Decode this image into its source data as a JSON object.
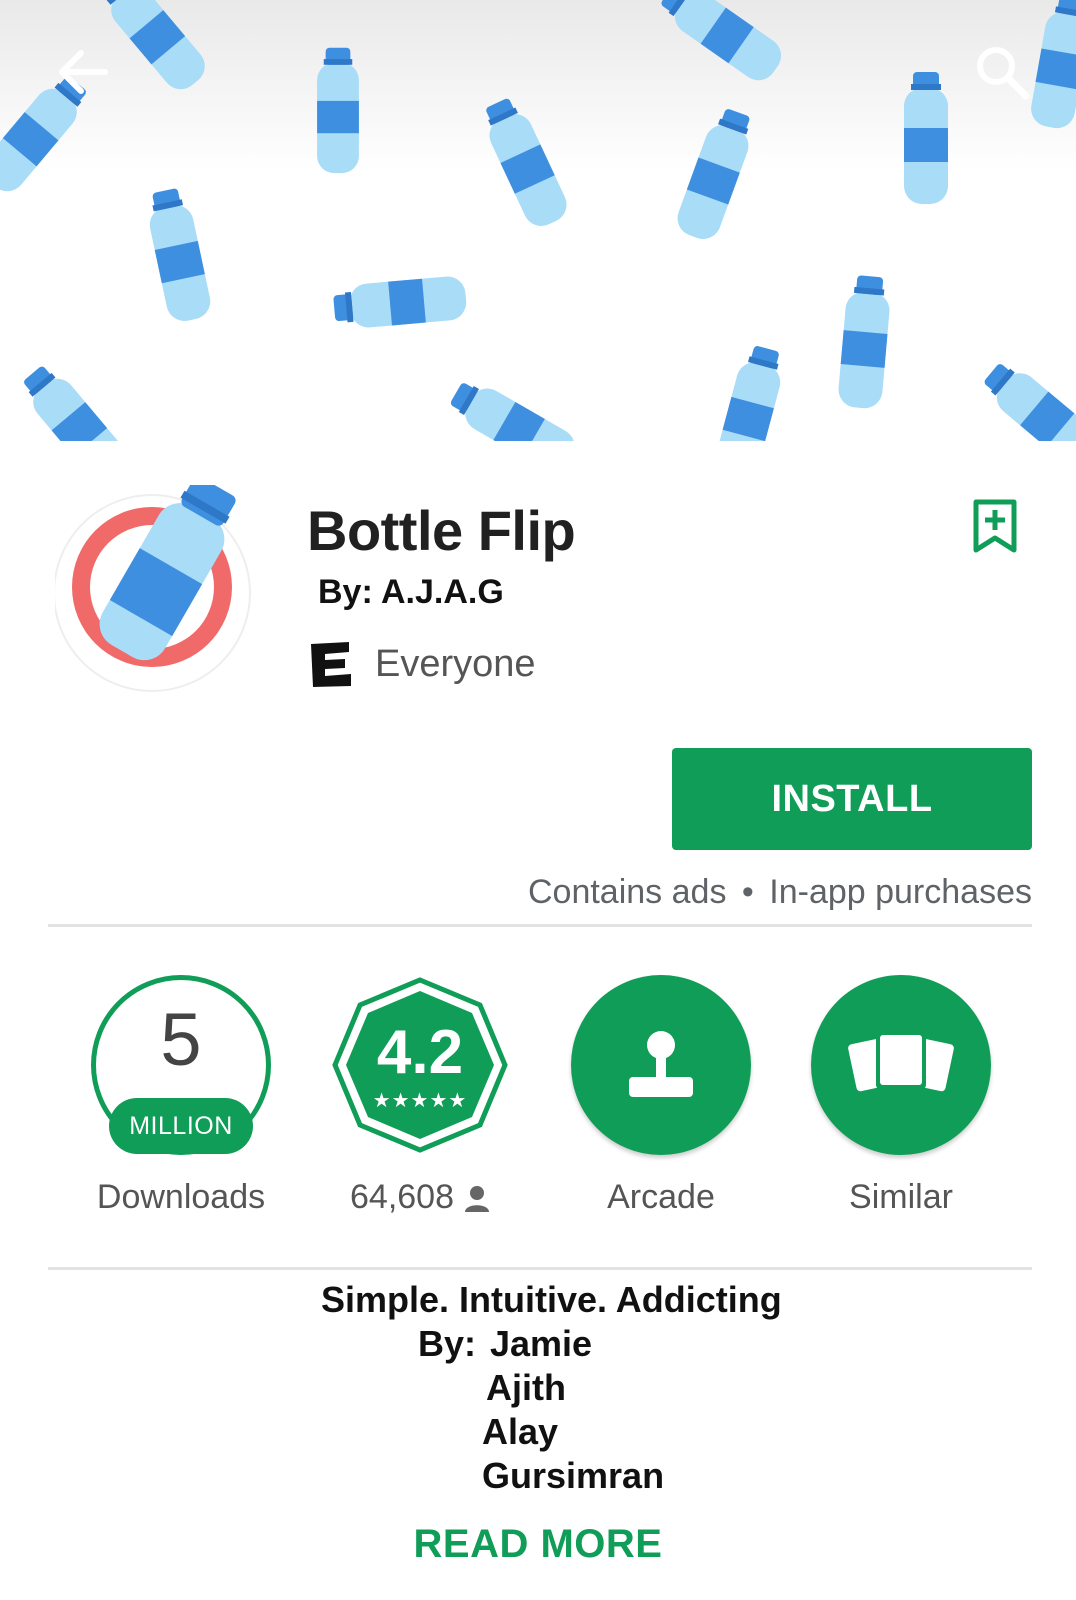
{
  "header": {
    "back_icon": "arrow-back-icon",
    "search_icon": "search-icon"
  },
  "app": {
    "title": "Bottle Flip",
    "byline": "By: A.J.A.G",
    "content_rating": "Everyone",
    "content_rating_badge": "E",
    "wishlist_icon": "bookmark-add-icon"
  },
  "actions": {
    "install_label": "INSTALL",
    "contains_ads": "Contains ads",
    "separator": "•",
    "in_app": "In-app purchases"
  },
  "stats": {
    "downloads_number": "5",
    "downloads_unit": "MILLION",
    "downloads_label": "Downloads",
    "rating_value": "4.2",
    "rating_stars": "★★★★★",
    "rating_count": "64,608",
    "category_label": "Arcade",
    "category_icon": "joystick-icon",
    "similar_label": "Similar",
    "similar_icon": "cards-icon"
  },
  "description": {
    "tagline": "Simple. Intuitive. Addicting",
    "by_prefix": "By:",
    "authors": [
      "Jamie",
      "Ajith",
      "Alay",
      "Gursimran"
    ]
  },
  "read_more": "READ MORE",
  "colors": {
    "accent": "#0f9d58",
    "bottle_blue": "#3f8fe0",
    "bottle_light": "#a9dcf7",
    "icon_red": "#f06a6a"
  }
}
